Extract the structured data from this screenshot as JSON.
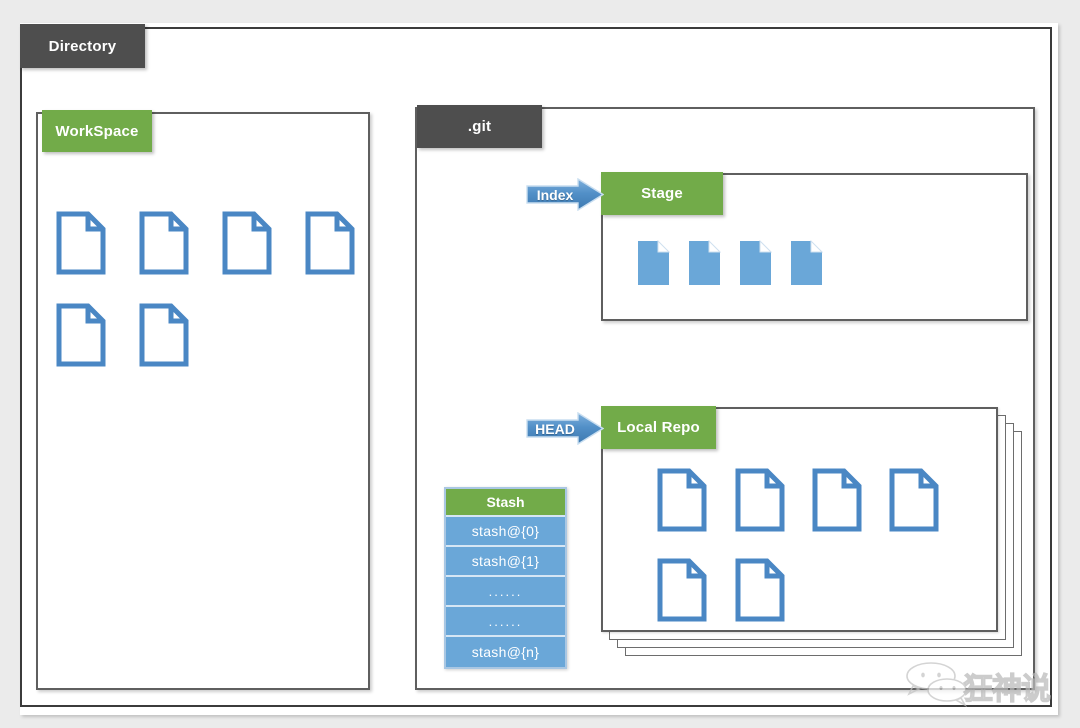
{
  "diagram": {
    "title": "Directory",
    "outer": {
      "label": "Directory"
    },
    "workspace": {
      "label": "WorkSpace",
      "files_row1": 4,
      "files_row2": 2,
      "file_icon": "document-icon"
    },
    "git": {
      "label": ".git",
      "index_arrow": {
        "label": "Index",
        "icon": "right-block-arrow-icon"
      },
      "head_arrow": {
        "label": "HEAD",
        "icon": "right-block-arrow-icon"
      },
      "stage": {
        "label": "Stage",
        "files": 4,
        "file_icon": "document-filled-icon"
      },
      "local_repo": {
        "label": "Local Repo",
        "stack_layers": 4,
        "files_row1": 4,
        "files_row2": 2,
        "file_icon": "document-icon"
      },
      "stash": {
        "header": "Stash",
        "rows": [
          "stash@{0}",
          "stash@{1}",
          "......",
          "......",
          "stash@{n}"
        ]
      }
    }
  },
  "watermark": {
    "text": "狂神说",
    "icon": "wechat-icon"
  },
  "colors": {
    "page_background": "#ebebeb",
    "panel_background": "#ffffff",
    "tab_dark": "#4e4e4e",
    "tab_green": "#72ab49",
    "accent_blue": "#4a87c4",
    "file_blue": "#6aa7d8",
    "border_gray": "#5f5f5f",
    "stash_row_blue": "#6aa7d8",
    "stash_border": "#d6e6f4"
  }
}
